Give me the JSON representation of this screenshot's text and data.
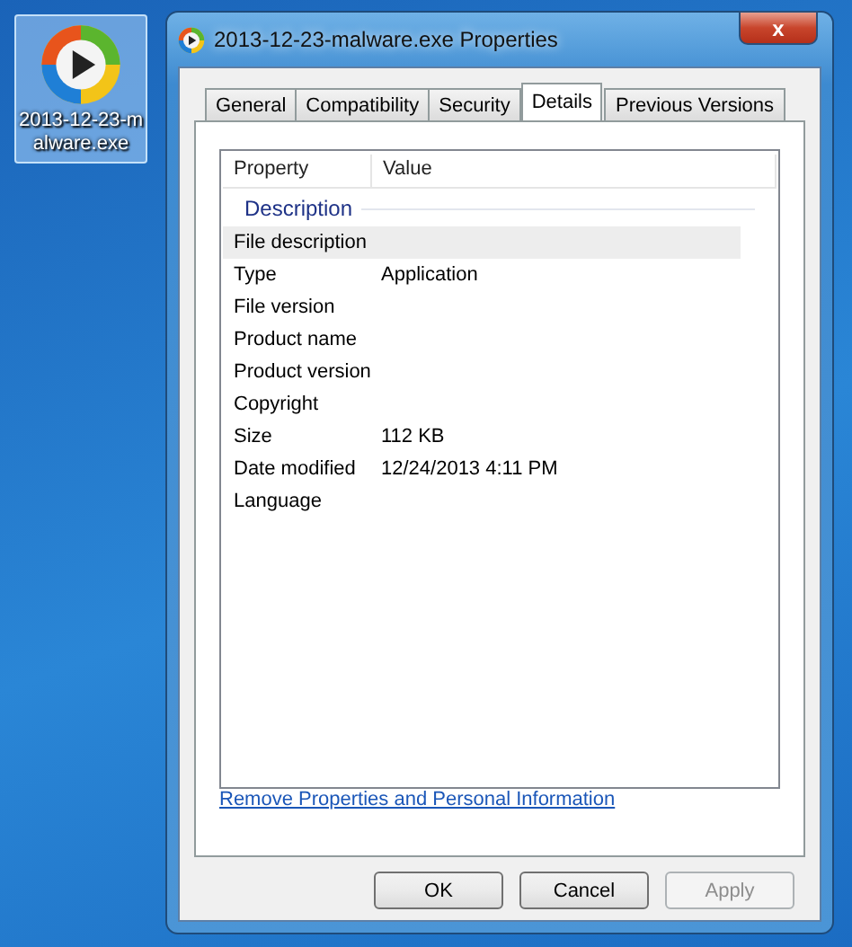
{
  "desktop_icon": {
    "label": "2013-12-23-malware.exe",
    "selected": true
  },
  "window": {
    "title": "2013-12-23-malware.exe Properties",
    "close": "x"
  },
  "tabs": [
    {
      "label": "General",
      "selected": false
    },
    {
      "label": "Compatibility",
      "selected": false
    },
    {
      "label": "Security",
      "selected": false
    },
    {
      "label": "Details",
      "selected": true
    },
    {
      "label": "Previous Versions",
      "selected": false
    }
  ],
  "details": {
    "columns": [
      "Property",
      "Value"
    ],
    "group": "Description",
    "rows": [
      {
        "property": "File description",
        "selected": true
      },
      {
        "property": "Type",
        "value": "Application",
        "selected": false
      },
      {
        "property": "File version",
        "selected": false
      },
      {
        "property": "Product name",
        "selected": false
      },
      {
        "property": "Product version",
        "selected": false
      },
      {
        "property": "Copyright",
        "selected": false
      },
      {
        "property": "Size",
        "value": "112 KB",
        "selected": false
      },
      {
        "property": "Date modified",
        "value": "12/24/2013 4:11 PM",
        "selected": false
      },
      {
        "property": "Language",
        "selected": false
      }
    ]
  },
  "link": "Remove Properties and Personal Information",
  "buttons": [
    {
      "label": "OK",
      "disabled": false
    },
    {
      "label": "Cancel",
      "disabled": false
    },
    {
      "label": "Apply",
      "disabled": true
    }
  ]
}
